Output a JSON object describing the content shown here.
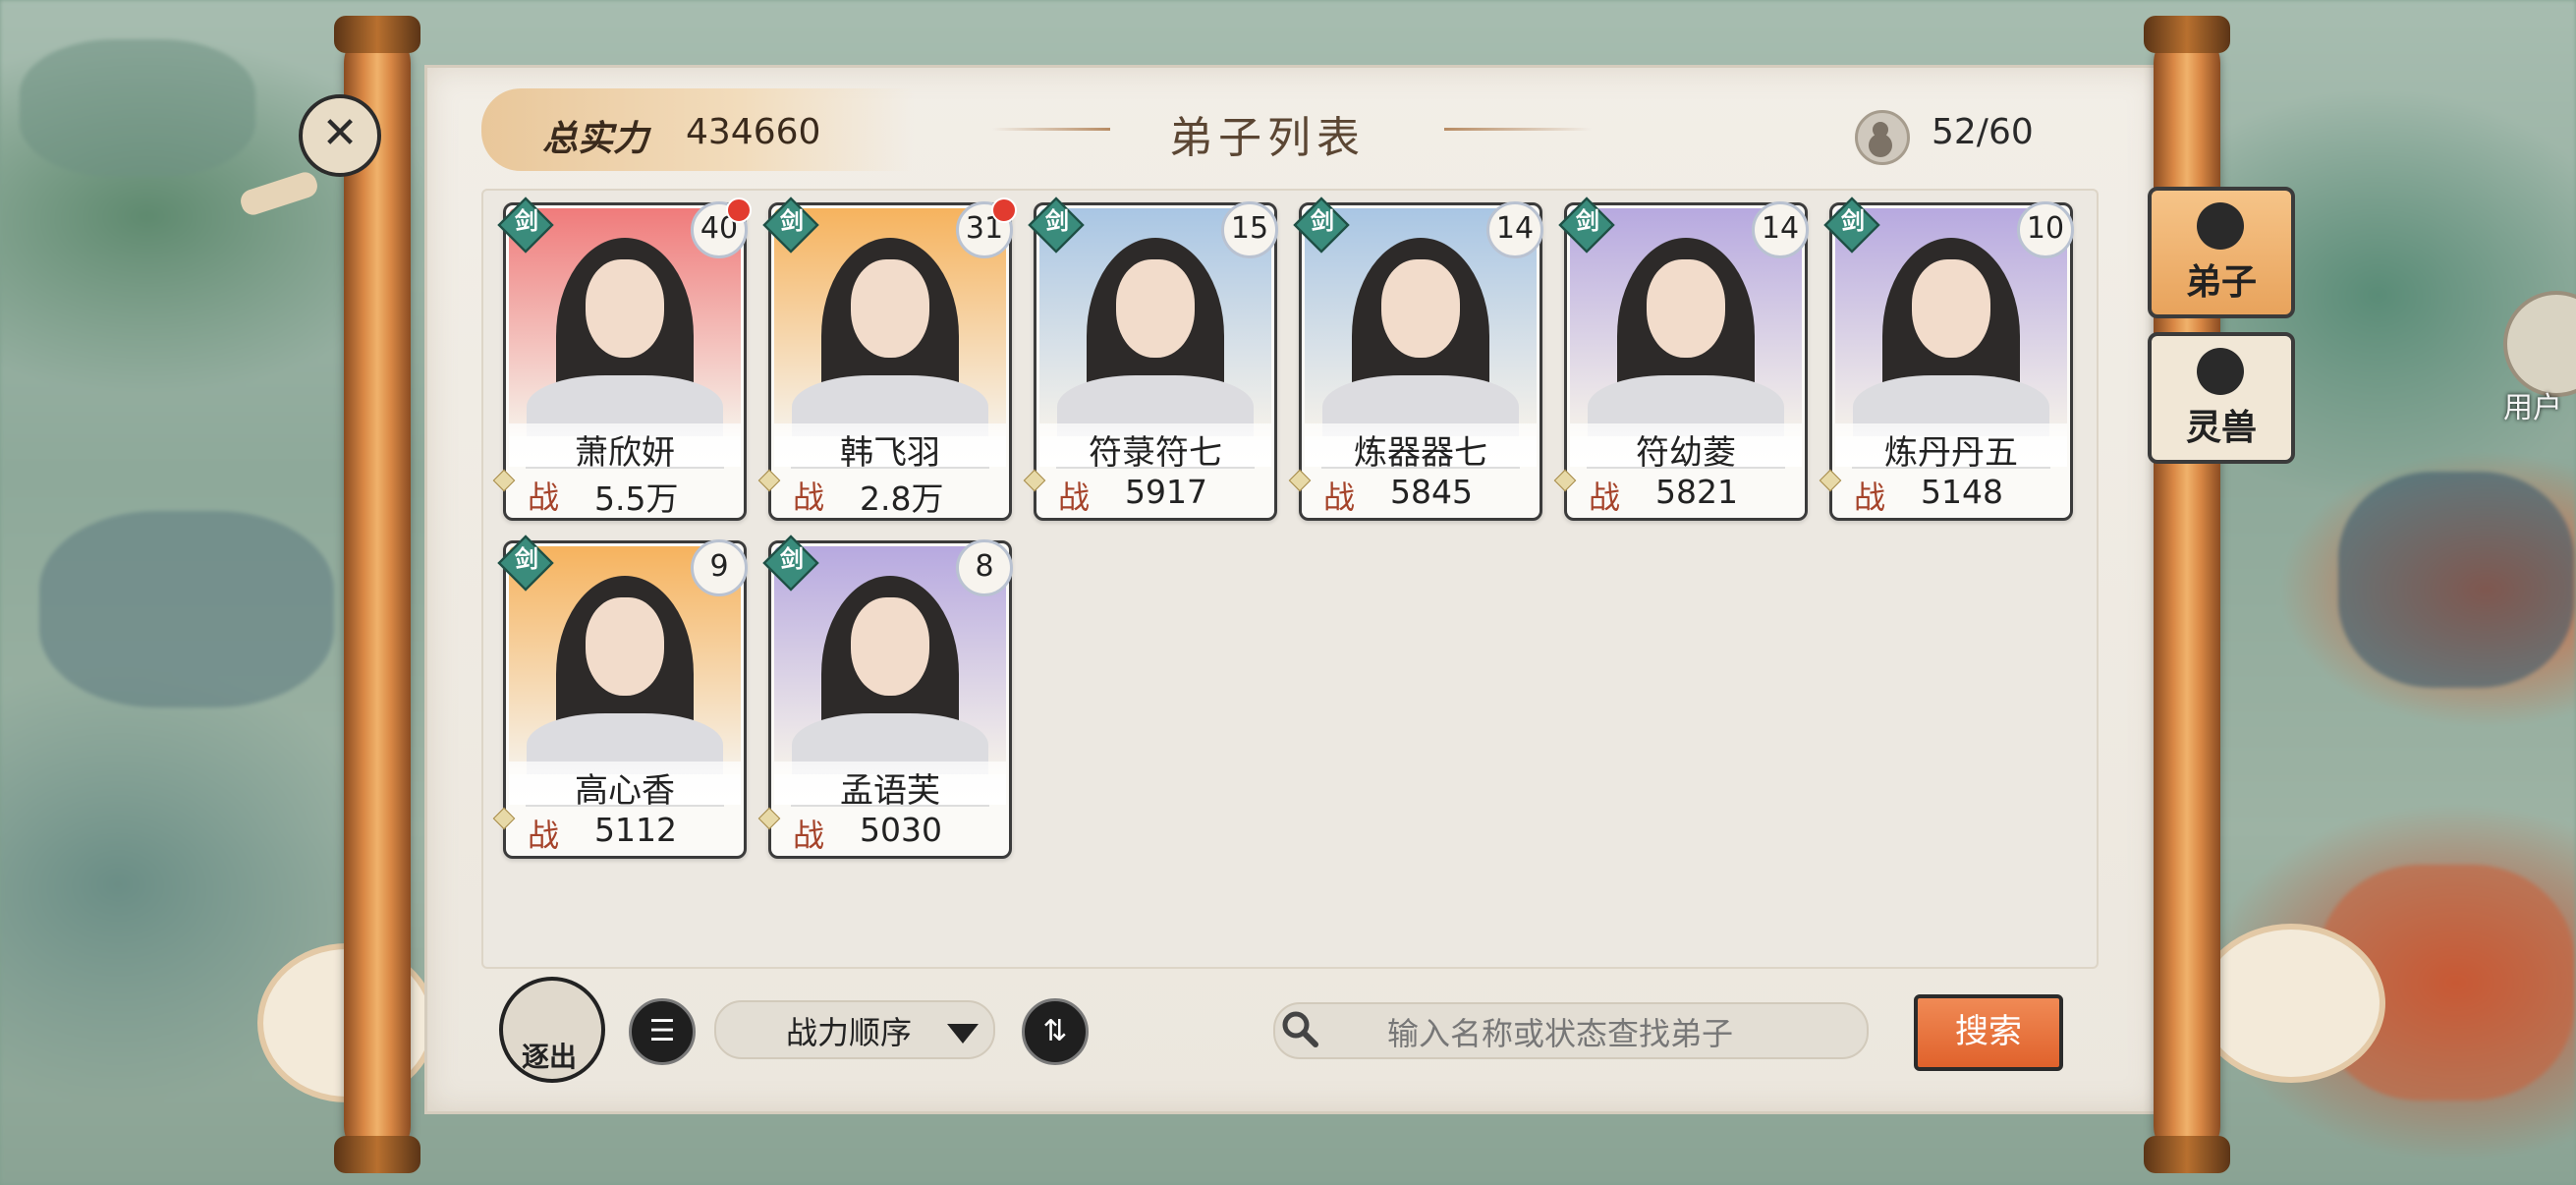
{
  "header": {
    "total_power_label": "总实力",
    "total_power_value": "434660",
    "title": "弟子列表",
    "capacity": "52/60"
  },
  "disciples": [
    {
      "name": "萧欣妍",
      "power_tag": "战",
      "power": "5.5万",
      "level": "40",
      "type": "剑",
      "notify": true,
      "bg": "#f07b7b"
    },
    {
      "name": "韩飞羽",
      "power_tag": "战",
      "power": "2.8万",
      "level": "31",
      "type": "剑",
      "notify": true,
      "bg": "#f6b35e"
    },
    {
      "name": "符菉符七",
      "power_tag": "战",
      "power": "5917",
      "level": "15",
      "type": "剑",
      "notify": false,
      "bg": "#a9c6e4"
    },
    {
      "name": "炼器器七",
      "power_tag": "战",
      "power": "5845",
      "level": "14",
      "type": "剑",
      "notify": false,
      "bg": "#a9c6e4"
    },
    {
      "name": "符幼菱",
      "power_tag": "战",
      "power": "5821",
      "level": "14",
      "type": "剑",
      "notify": false,
      "bg": "#b7a9e0"
    },
    {
      "name": "炼丹丹五",
      "power_tag": "战",
      "power": "5148",
      "level": "10",
      "type": "剑",
      "notify": false,
      "bg": "#b7a9e0"
    },
    {
      "name": "高心香",
      "power_tag": "战",
      "power": "5112",
      "level": "9",
      "type": "剑",
      "notify": false,
      "bg": "#f6b35e"
    },
    {
      "name": "孟语芙",
      "power_tag": "战",
      "power": "5030",
      "level": "8",
      "type": "剑",
      "notify": false,
      "bg": "#b7a9e0"
    }
  ],
  "side_tabs": [
    {
      "label": "弟子",
      "active": true
    },
    {
      "label": "灵兽",
      "active": false
    }
  ],
  "toolbar": {
    "expel_label": "逐出",
    "sort_label": "战力顺序",
    "search_placeholder": "输入名称或状态查找弟子",
    "search_button": "搜索"
  },
  "user_label": "用户"
}
